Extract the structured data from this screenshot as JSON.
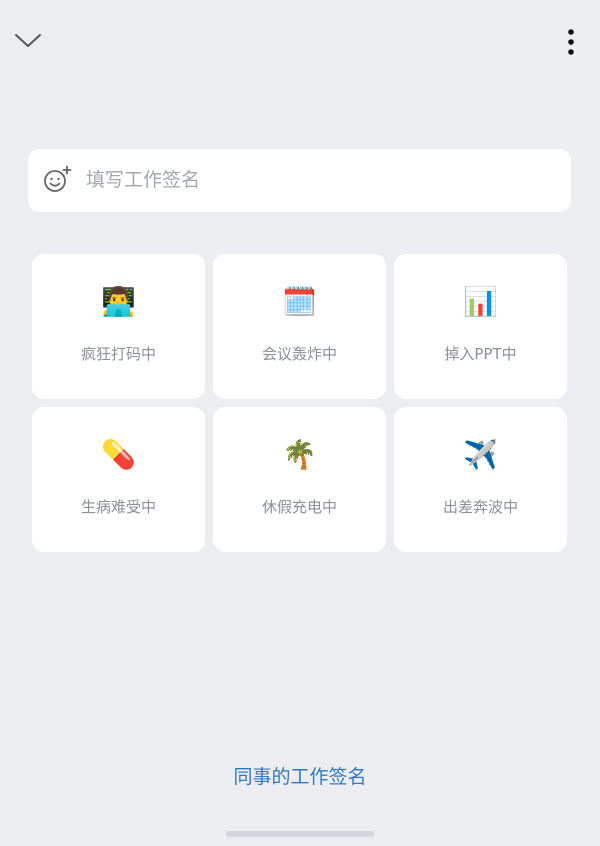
{
  "header": {
    "collapse_icon": "chevron-down-icon",
    "more_icon": "more-vertical-icon"
  },
  "signature": {
    "placeholder": "填写工作签名",
    "emoji_icon": "emoji-add-icon"
  },
  "statuses": [
    {
      "emoji": "👨‍💻",
      "label": "疯狂打码中"
    },
    {
      "emoji": "🗓️",
      "label": "会议轰炸中"
    },
    {
      "emoji": "📊",
      "label": "掉入PPT中"
    },
    {
      "emoji": "💊",
      "label": "生病难受中"
    },
    {
      "emoji": "🌴",
      "label": "休假充电中"
    },
    {
      "emoji": "✈️",
      "label": "出差奔波中"
    }
  ],
  "footer": {
    "coworker_signatures": "同事的工作签名"
  },
  "colors": {
    "background": "#ECEDF1",
    "card": "#FFFFFF",
    "link": "#2E78C2",
    "label": "#8A8F98"
  }
}
